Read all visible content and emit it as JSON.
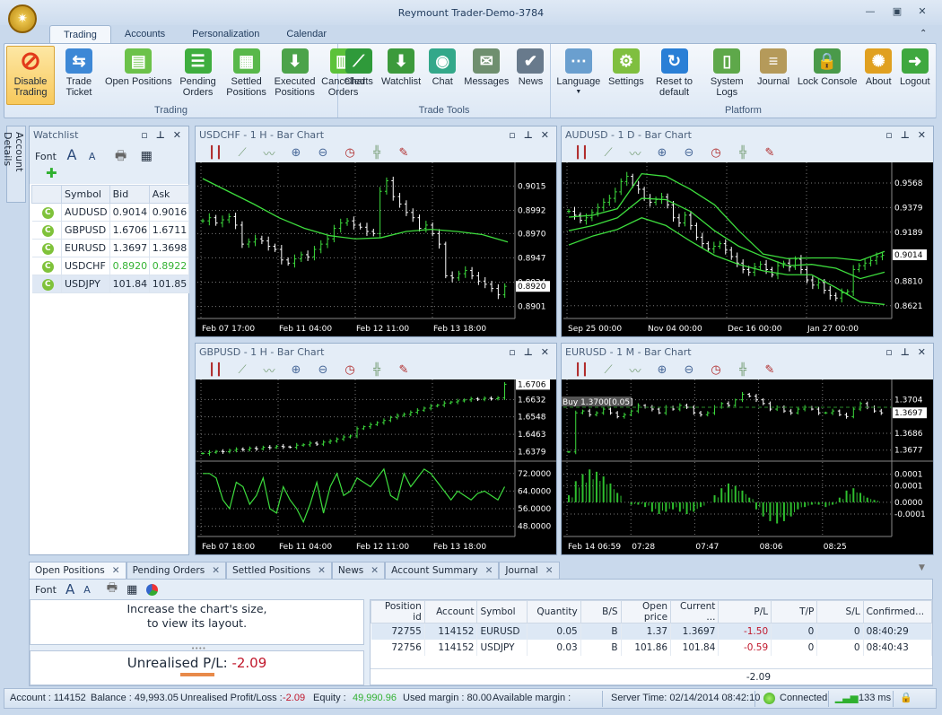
{
  "window": {
    "title": "Reymount Trader-Demo-3784",
    "logo_text": "R"
  },
  "ribbon_tabs": [
    "Trading",
    "Accounts",
    "Personalization",
    "Calendar"
  ],
  "ribbon_groups": [
    {
      "label": "Trading",
      "buttons": [
        {
          "label": "Disable Trading",
          "icon": "no-entry-icon",
          "color": "#e23a1a",
          "active": true
        },
        {
          "label": "Trade Ticket",
          "icon": "trade-ticket-icon",
          "color": "#3d88d6"
        },
        {
          "label": "Open Positions",
          "icon": "open-positions-icon",
          "color": "#6cc24a"
        },
        {
          "label": "Pending Orders",
          "icon": "pending-orders-icon",
          "color": "#3fae3f"
        },
        {
          "label": "Settled Positions",
          "icon": "settled-positions-icon",
          "color": "#58b84a"
        },
        {
          "label": "Executed Positions",
          "icon": "executed-positions-icon",
          "color": "#4ca34a"
        },
        {
          "label": "Cancelled Orders",
          "icon": "cancelled-orders-icon",
          "color": "#5cc23a"
        }
      ]
    },
    {
      "label": "Trade Tools",
      "buttons": [
        {
          "label": "Charts",
          "icon": "charts-icon",
          "color": "#2f9a3a"
        },
        {
          "label": "Watchlist",
          "icon": "watchlist-icon",
          "color": "#3c9a3c"
        },
        {
          "label": "Chat",
          "icon": "chat-icon",
          "color": "#33a88a"
        },
        {
          "label": "Messages",
          "icon": "messages-icon",
          "color": "#6f8f6f"
        },
        {
          "label": "News",
          "icon": "news-icon",
          "color": "#687a8c"
        }
      ]
    },
    {
      "label": "Platform",
      "buttons": [
        {
          "label": "Language",
          "icon": "language-icon",
          "color": "#6a9fcf",
          "dropdown": true
        },
        {
          "label": "Settings",
          "icon": "settings-icon",
          "color": "#7fbf3f"
        },
        {
          "label": "Reset to default",
          "icon": "reset-icon",
          "color": "#2a7fd6"
        },
        {
          "label": "System Logs",
          "icon": "system-logs-icon",
          "color": "#5ea84a"
        },
        {
          "label": "Journal",
          "icon": "journal-icon",
          "color": "#b59a5a"
        },
        {
          "label": "Lock Console",
          "icon": "lock-console-icon",
          "color": "#4a9a4a"
        },
        {
          "label": "About",
          "icon": "about-icon",
          "color": "#e0a020"
        },
        {
          "label": "Logout",
          "icon": "logout-icon",
          "color": "#3fa83f"
        }
      ]
    }
  ],
  "side_tab": "Account Details",
  "watchlist": {
    "title": "Watchlist",
    "font_label": "Font",
    "columns": [
      "Symbol",
      "Bid",
      "Ask"
    ],
    "rows": [
      {
        "symbol": "AUDUSD",
        "bid": "0.9014",
        "ask": "0.9016"
      },
      {
        "symbol": "GBPUSD",
        "bid": "1.6706",
        "ask": "1.6711"
      },
      {
        "symbol": "EURUSD",
        "bid": "1.3697",
        "ask": "1.3698"
      },
      {
        "symbol": "USDCHF",
        "bid": "0.8920",
        "ask": "0.8922",
        "up": true
      },
      {
        "symbol": "USDJPY",
        "bid": "101.84",
        "ask": "101.85"
      }
    ]
  },
  "chart_data": [
    {
      "title": "USDCHF - 1 H - Bar Chart",
      "type": "bar",
      "x_ticks": [
        "Feb 07 17:00",
        "Feb 11 04:00",
        "Feb 12 11:00",
        "Feb 13 18:00"
      ],
      "current_price": "0.8920",
      "panes": [
        {
          "ylim": [
            0.8893,
            0.9034
          ],
          "y_ticks": [
            "0.9015",
            "0.8992",
            "0.8970",
            "0.8947",
            "0.8924",
            "0.8901"
          ],
          "bars": [
            0.8982,
            0.8985,
            0.898,
            0.8983,
            0.8986,
            0.8978,
            0.896,
            0.8962,
            0.8965,
            0.8963,
            0.8958,
            0.8955,
            0.8945,
            0.8942,
            0.8946,
            0.895,
            0.8948,
            0.8955,
            0.896,
            0.8965,
            0.8975,
            0.898,
            0.8982,
            0.8978,
            0.8976,
            0.8972,
            0.897,
            0.901,
            0.902,
            0.9005,
            0.8998,
            0.899,
            0.8985,
            0.8975,
            0.8978,
            0.897,
            0.896,
            0.893,
            0.8928,
            0.8932,
            0.8935,
            0.893,
            0.8925,
            0.8922,
            0.8918,
            0.8912,
            0.892
          ],
          "lines": [
            [
              0.9022,
              0.901,
              0.8998,
              0.8985,
              0.8975,
              0.8968,
              0.8965,
              0.8966,
              0.8972,
              0.8974,
              0.8972,
              0.8969,
              0.8962
            ]
          ]
        }
      ]
    },
    {
      "title": "AUDUSD - 1 D - Bar Chart",
      "type": "bar",
      "x_ticks": [
        "Sep 25 00:00",
        "Nov 04 00:00",
        "Dec 16 00:00",
        "Jan 27 00:00"
      ],
      "current_price": "0.9014",
      "panes": [
        {
          "ylim": [
            0.855,
            0.97
          ],
          "y_ticks": [
            "0.9568",
            "0.9379",
            "0.9189",
            "0.8810",
            "0.8621"
          ],
          "bars": [
            0.935,
            0.932,
            0.928,
            0.93,
            0.934,
            0.938,
            0.942,
            0.945,
            0.95,
            0.958,
            0.962,
            0.955,
            0.952,
            0.945,
            0.942,
            0.944,
            0.946,
            0.94,
            0.93,
            0.926,
            0.932,
            0.924,
            0.915,
            0.91,
            0.906,
            0.908,
            0.91,
            0.905,
            0.9,
            0.895,
            0.89,
            0.888,
            0.892,
            0.894,
            0.89,
            0.886,
            0.893,
            0.895,
            0.892,
            0.898,
            0.89,
            0.882,
            0.878,
            0.88,
            0.874,
            0.87,
            0.868,
            0.872,
            0.873,
            0.89,
            0.893,
            0.895,
            0.897,
            0.9,
            0.901
          ],
          "lines": [
            [
              0.9305,
              0.932,
              0.937,
              0.964,
              0.962,
              0.952,
              0.94,
              0.92,
              0.902,
              0.8985,
              0.899,
              0.899,
              0.897,
              0.904
            ],
            [
              0.92,
              0.924,
              0.93,
              0.945,
              0.944,
              0.935,
              0.92,
              0.908,
              0.9,
              0.893,
              0.894,
              0.891,
              0.883,
              0.888
            ],
            [
              0.909,
              0.916,
              0.921,
              0.93,
              0.924,
              0.912,
              0.901,
              0.894,
              0.889,
              0.886,
              0.886,
              0.876,
              0.865,
              0.863
            ]
          ]
        }
      ]
    },
    {
      "title": "GBPUSD - 1 H - Bar Chart",
      "type": "bar",
      "x_ticks": [
        "Feb 07 18:00",
        "Feb 11 04:00",
        "Feb 12 11:00",
        "Feb 13 18:00"
      ],
      "current_price": "1.6706",
      "panes": [
        {
          "ylim": [
            1.635,
            1.6712
          ],
          "y_ticks": [
            "1.6632",
            "1.6548",
            "1.6463",
            "1.6379"
          ],
          "bars": [
            1.637,
            1.6375,
            1.638,
            1.6378,
            1.6385,
            1.639,
            1.6388,
            1.6395,
            1.6392,
            1.64,
            1.6398,
            1.6405,
            1.6402,
            1.64,
            1.641,
            1.6412,
            1.642,
            1.6415,
            1.6425,
            1.643,
            1.644,
            1.645,
            1.6455,
            1.649,
            1.65,
            1.651,
            1.652,
            1.653,
            1.6545,
            1.6555,
            1.656,
            1.657,
            1.658,
            1.659,
            1.66,
            1.6605,
            1.6615,
            1.662,
            1.6625,
            1.663,
            1.6635,
            1.6633,
            1.6638,
            1.6636,
            1.664,
            1.6706
          ],
          "lines": []
        },
        {
          "ylim": [
            45,
            76
          ],
          "y_ticks": [
            "72.0000",
            "64.0000",
            "56.0000",
            "48.0000"
          ],
          "line": [
            72,
            72,
            70,
            60,
            56,
            68,
            66,
            58,
            62,
            70,
            56,
            54,
            66,
            60,
            56,
            50,
            58,
            68,
            54,
            66,
            72,
            62,
            64,
            70,
            68,
            66,
            70,
            74,
            62,
            60,
            72,
            66,
            70,
            74,
            72,
            68,
            64,
            60,
            64,
            62,
            60,
            63,
            64,
            62,
            60,
            66
          ]
        }
      ]
    },
    {
      "title": "EURUSD - 1 M - Bar Chart",
      "type": "bar",
      "x_ticks": [
        "Feb 14 06:59",
        "07:28",
        "07:47",
        "08:06",
        "08:25"
      ],
      "current_price": "1.3697",
      "order_line": {
        "label": "Buy 1.3700[0.05]",
        "price": 1.37
      },
      "panes": [
        {
          "ylim": [
            1.3673,
            1.3713
          ],
          "y_ticks": [
            "1.3704",
            "1.3686",
            "1.3677"
          ],
          "bars": [
            1.3676,
            1.3697,
            1.3698,
            1.3696,
            1.3697,
            1.3699,
            1.3697,
            1.3695,
            1.3696,
            1.3698,
            1.3701,
            1.37,
            1.3699,
            1.3697,
            1.37,
            1.3699,
            1.3701,
            1.37,
            1.3697,
            1.3696,
            1.3697,
            1.37,
            1.3702,
            1.3701,
            1.3704,
            1.3707,
            1.3706,
            1.3704,
            1.3702,
            1.3699,
            1.37,
            1.3698,
            1.3697,
            1.3699,
            1.37,
            1.3699,
            1.3697,
            1.3697,
            1.3698,
            1.3696,
            1.3695,
            1.3699,
            1.3702,
            1.37,
            1.3698,
            1.3697
          ],
          "lines": []
        },
        {
          "ylim": [
            -0.00013,
            0.00016
          ],
          "y_ticks": [
            "0.0001",
            "0.0001",
            "0.0000",
            "-0.0001"
          ],
          "y_tick_values": [
            0.00012,
            7e-05,
            0.0,
            -5e-05
          ],
          "hist": [
            3e-05,
            9e-05,
            0.00012,
            0.00014,
            0.00013,
            0.00011,
            8e-05,
            4e-05,
            0.0,
            -1e-05,
            -1e-05,
            -2e-05,
            -4e-05,
            -5e-05,
            -4e-05,
            -3e-05,
            -4e-05,
            -5e-05,
            -4e-05,
            -2e-05,
            0.0,
            3e-05,
            6e-05,
            8e-05,
            7e-05,
            5e-05,
            2e-05,
            -3e-05,
            -6e-05,
            -8e-05,
            -9e-05,
            -8e-05,
            -6e-05,
            -3e-05,
            -2e-05,
            -1e-05,
            -1e-05,
            -2e-05,
            -1e-05,
            2e-05,
            5e-05,
            6e-05,
            4e-05,
            2e-05,
            1e-05,
            0.0
          ]
        }
      ]
    }
  ],
  "bottom": {
    "tabs": [
      "Open Positions",
      "Pending Orders",
      "Settled Positions",
      "News",
      "Account Summary",
      "Journal"
    ],
    "font_label": "Font",
    "chart_hint": "Increase the chart's size,\nto view its layout.",
    "unrealised_label": "Unrealised P/L: ",
    "unrealised_value": "-2.09",
    "columns": [
      "Position id",
      "Account",
      "Symbol",
      "Quantity",
      "B/S",
      "Open price",
      "Current ...",
      "P/L",
      "T/P",
      "S/L",
      "Confirmed..."
    ],
    "rows": [
      [
        "72755",
        "114152",
        "EURUSD",
        "0.05",
        "B",
        "1.37",
        "1.3697",
        "-1.50",
        "0",
        "0",
        "08:40:29"
      ],
      [
        "72756",
        "114152",
        "USDJPY",
        "0.03",
        "B",
        "101.86",
        "101.84",
        "-0.59",
        "0",
        "0",
        "08:40:43"
      ]
    ],
    "total_pl": "-2.09"
  },
  "status": {
    "account": "Account : 114152",
    "balance": "Balance : 49,993.05",
    "unrealised_label": "Unrealised Profit/Loss : ",
    "unrealised_value": "-2.09",
    "equity_label": "Equity : ",
    "equity_value": "49,990.96",
    "used_margin": "Used margin : 80.00",
    "available_margin": "Available margin :",
    "server_time": "Server Time: 02/14/2014 08:42:10",
    "connection": "Connected",
    "latency": "133 ms"
  }
}
